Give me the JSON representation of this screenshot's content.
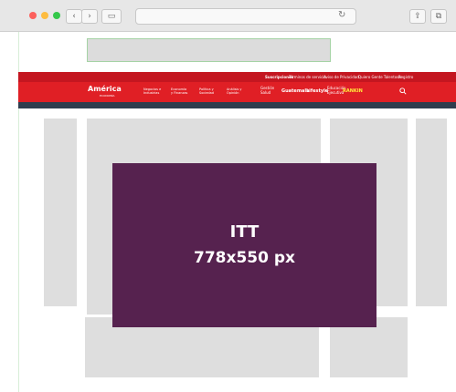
{
  "browser": {
    "traffic_lights": {
      "close": "#fc605c",
      "minimize": "#fdbc40",
      "zoom": "#34c84a"
    },
    "back_glyph": "‹",
    "forward_glyph": "›",
    "sidebar_glyph": "▭",
    "reload_glyph": "↻",
    "share_glyph": "⇪",
    "tabs_glyph": "⧉"
  },
  "site": {
    "top_links": [
      "Suscripciones",
      "Términos de servicio",
      "Aviso de Privacidad",
      "Quiero Gente Talentosa",
      "Registro"
    ],
    "brand": {
      "name": "América",
      "tagline": "ECONOMÍA"
    },
    "nav_items": [
      "Negocios e Industrias",
      "Economía y Finanzas",
      "Política y Sociedad",
      "Análisis y Opinión"
    ],
    "nav_bold_items": [
      "Gestión Salud",
      "Guatemala",
      "Lifestyle",
      "Educación Ejecutiva"
    ],
    "nav_badge": "RANKIN",
    "accent_color": "#e01f25",
    "dark_bar_color": "#2f3d4e"
  },
  "ad": {
    "title": "ITT",
    "size": "778x550 px",
    "color": "#56224f"
  }
}
